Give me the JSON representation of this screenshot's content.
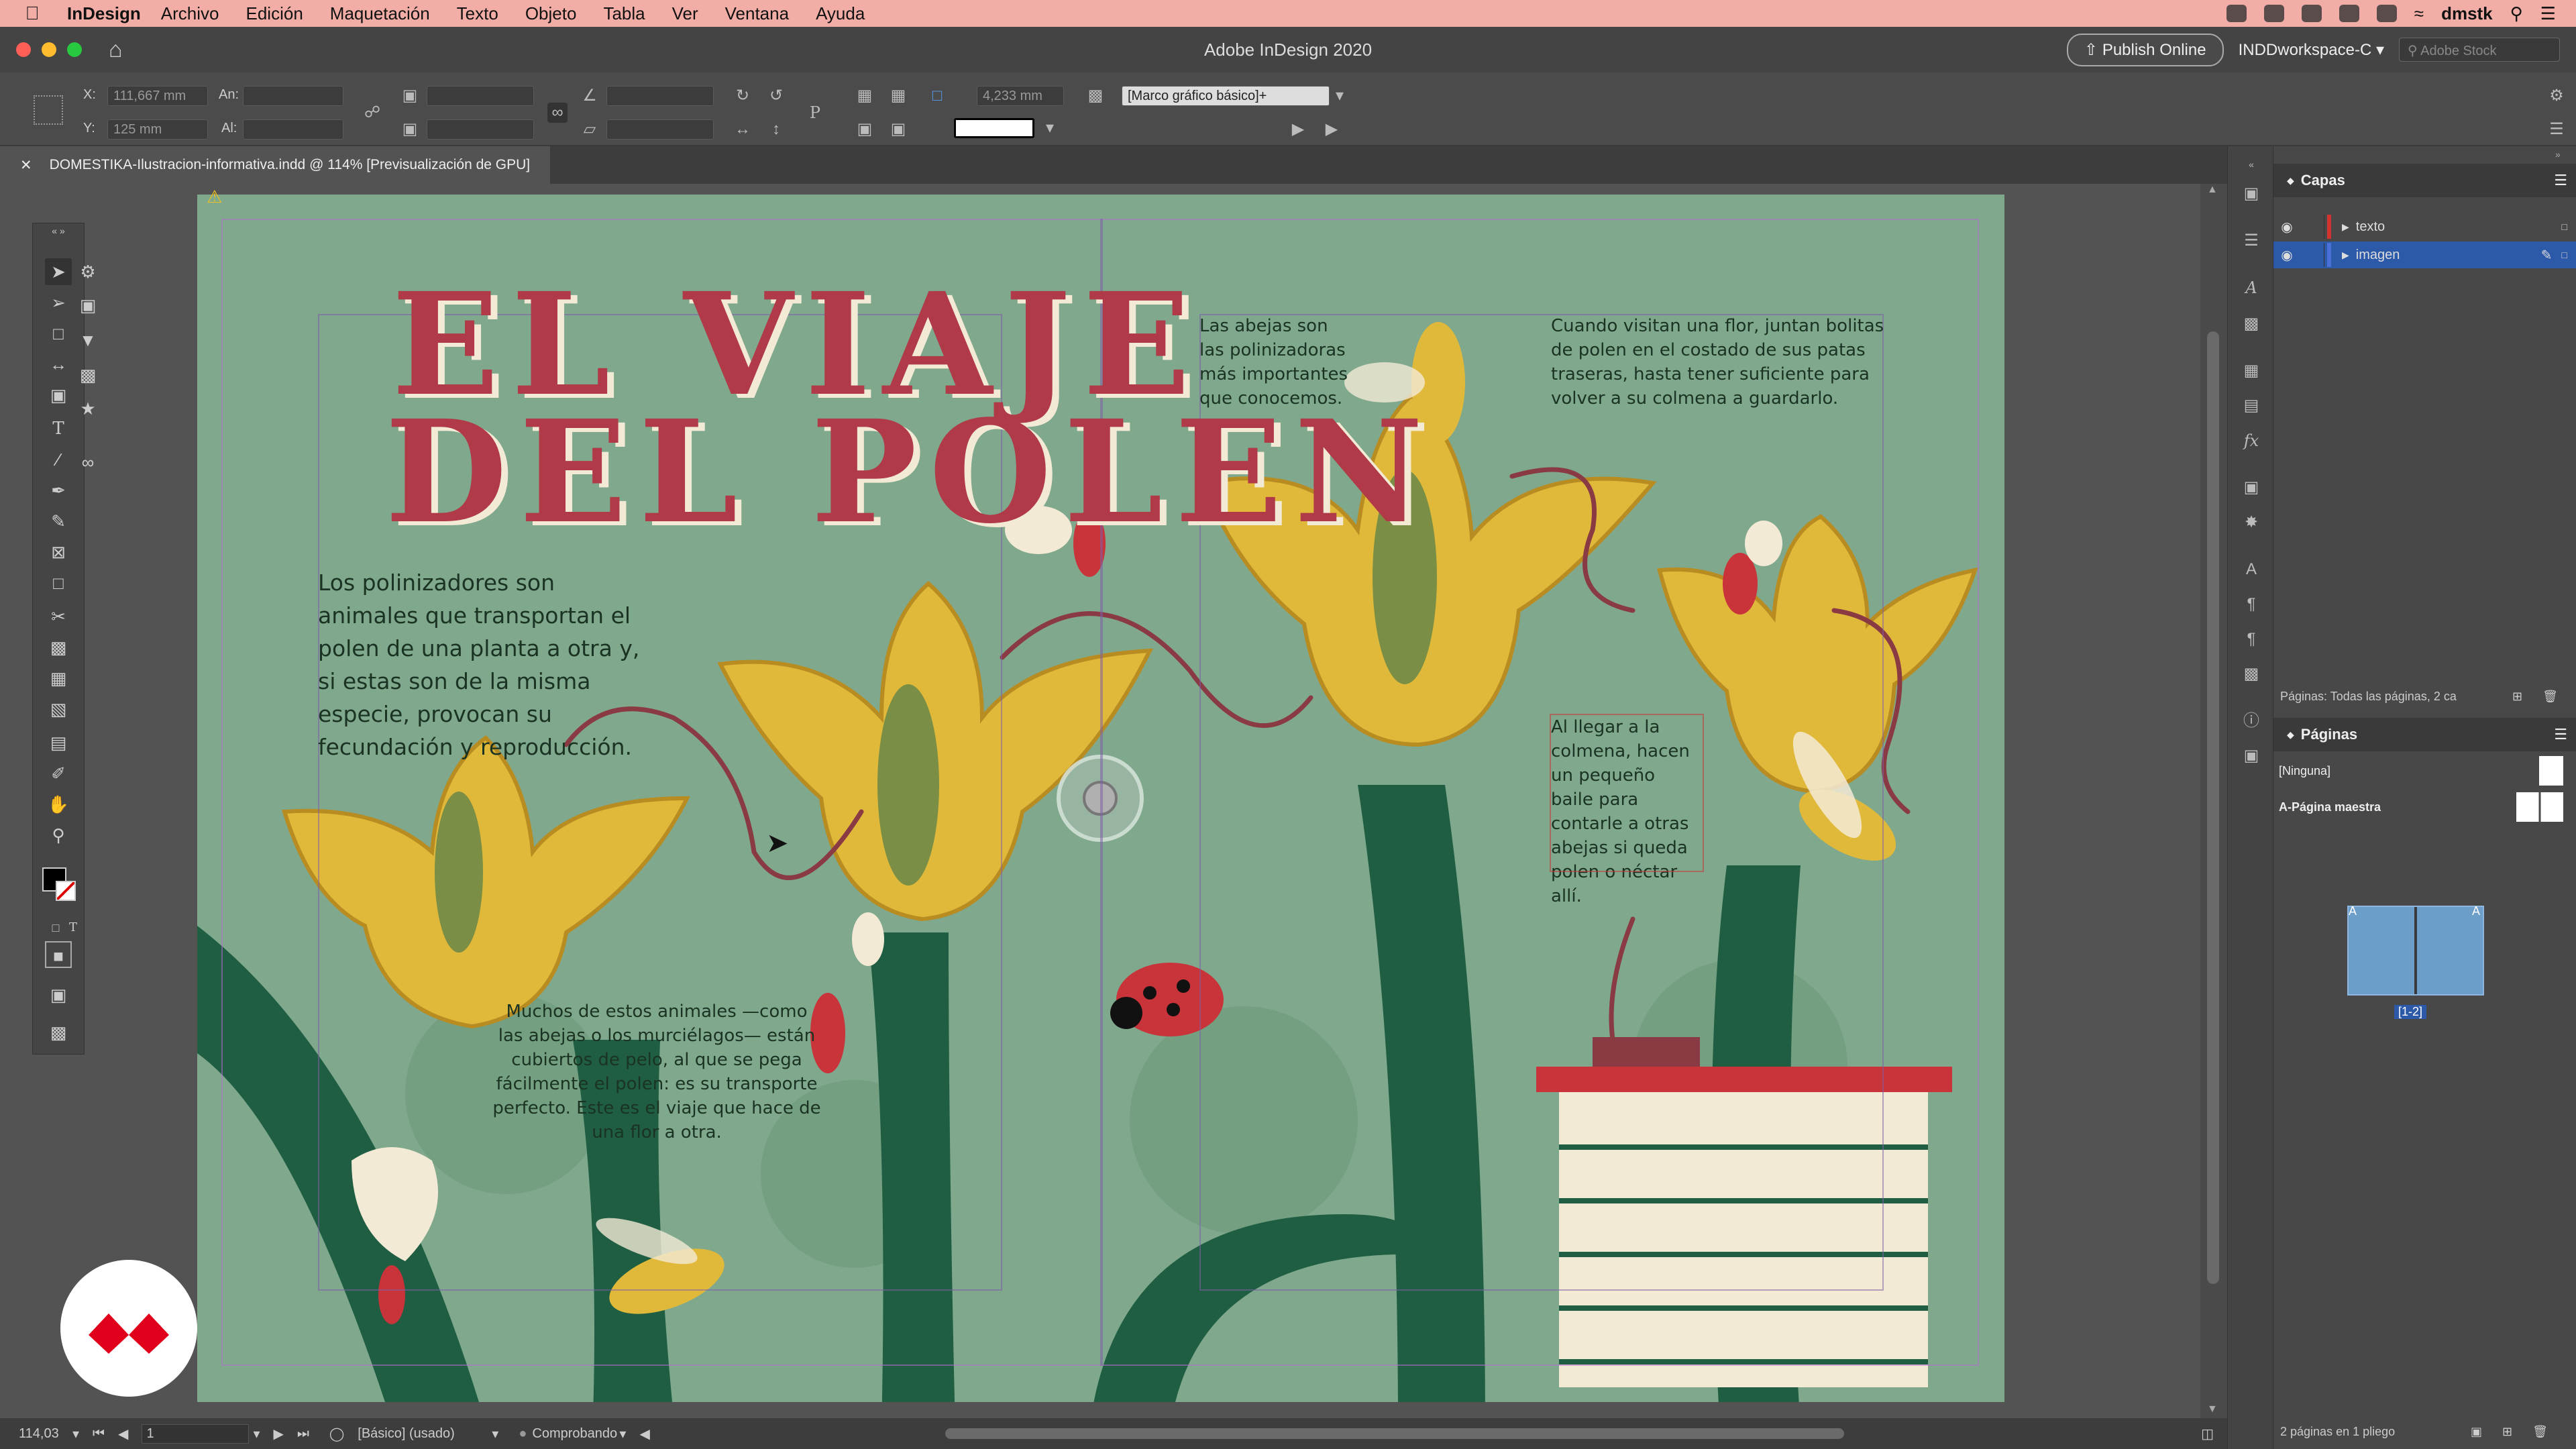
{
  "menubar": {
    "app": "InDesign",
    "items": [
      "Archivo",
      "Edición",
      "Maquetación",
      "Texto",
      "Objeto",
      "Tabla",
      "Ver",
      "Ventana",
      "Ayuda"
    ],
    "user": "dmstk"
  },
  "window": {
    "title": "Adobe InDesign 2020",
    "publish": "Publish Online",
    "workspace": "INDDworkspace-C",
    "stock_placeholder": "Adobe Stock"
  },
  "control": {
    "x_label": "X:",
    "x_value": "111,667 mm",
    "y_label": "Y:",
    "y_value": "125 mm",
    "w_label": "An:",
    "h_label": "Al:",
    "stroke_value": "4,233 mm",
    "frame_style": "[Marco gráfico básico]+"
  },
  "doc": {
    "tab": "DOMESTIKA-Ilustracion-informativa.indd @ 114% [Previsualización de GPU]"
  },
  "spread": {
    "title_line1": "EL VIAJE",
    "title_line2": "DEL POLEN",
    "text1": "Los polinizadores son animales que transportan el polen de una planta a otra y, si estas son de la misma especie, provocan su fecundación y reproducción.",
    "text2": "Muchos de estos animales —como las abejas o los murciélagos— están cubiertos de pelo, al que se pega fácilmente el polen: es su transporte perfecto. Este es el viaje que hace de una flor a otra.",
    "text3": "Las abejas son las polinizadoras más importantes que conocemos.",
    "text4": "Cuando visitan una flor, juntan bolitas de polen en el costado de sus patas traseras, hasta tener suficiente para volver a su colmena a guardarlo.",
    "text5": "Al llegar a la colmena, hacen un pequeño baile para contarle a otras abejas si queda polen o néctar allí."
  },
  "status": {
    "zoom": "114,03",
    "page": "1",
    "style": "[Básico] (usado)",
    "preflight": "Comprobando"
  },
  "layers": {
    "title": "Capas",
    "items": [
      {
        "name": "texto",
        "color": "#d0342c"
      },
      {
        "name": "imagen",
        "color": "#4a6fd6"
      }
    ],
    "footer": "Páginas: Todas las páginas, 2 ca"
  },
  "pages": {
    "title": "Páginas",
    "none": "[Ninguna]",
    "master": "A-Página maestra",
    "label": "[1-2]",
    "footer": "2 páginas en 1 pliego",
    "A": "A"
  },
  "colors": {
    "menubar": "#f2aea6",
    "spread": "#7fa88c",
    "accent": "#b03a48",
    "selected": "#2d5aa8"
  }
}
